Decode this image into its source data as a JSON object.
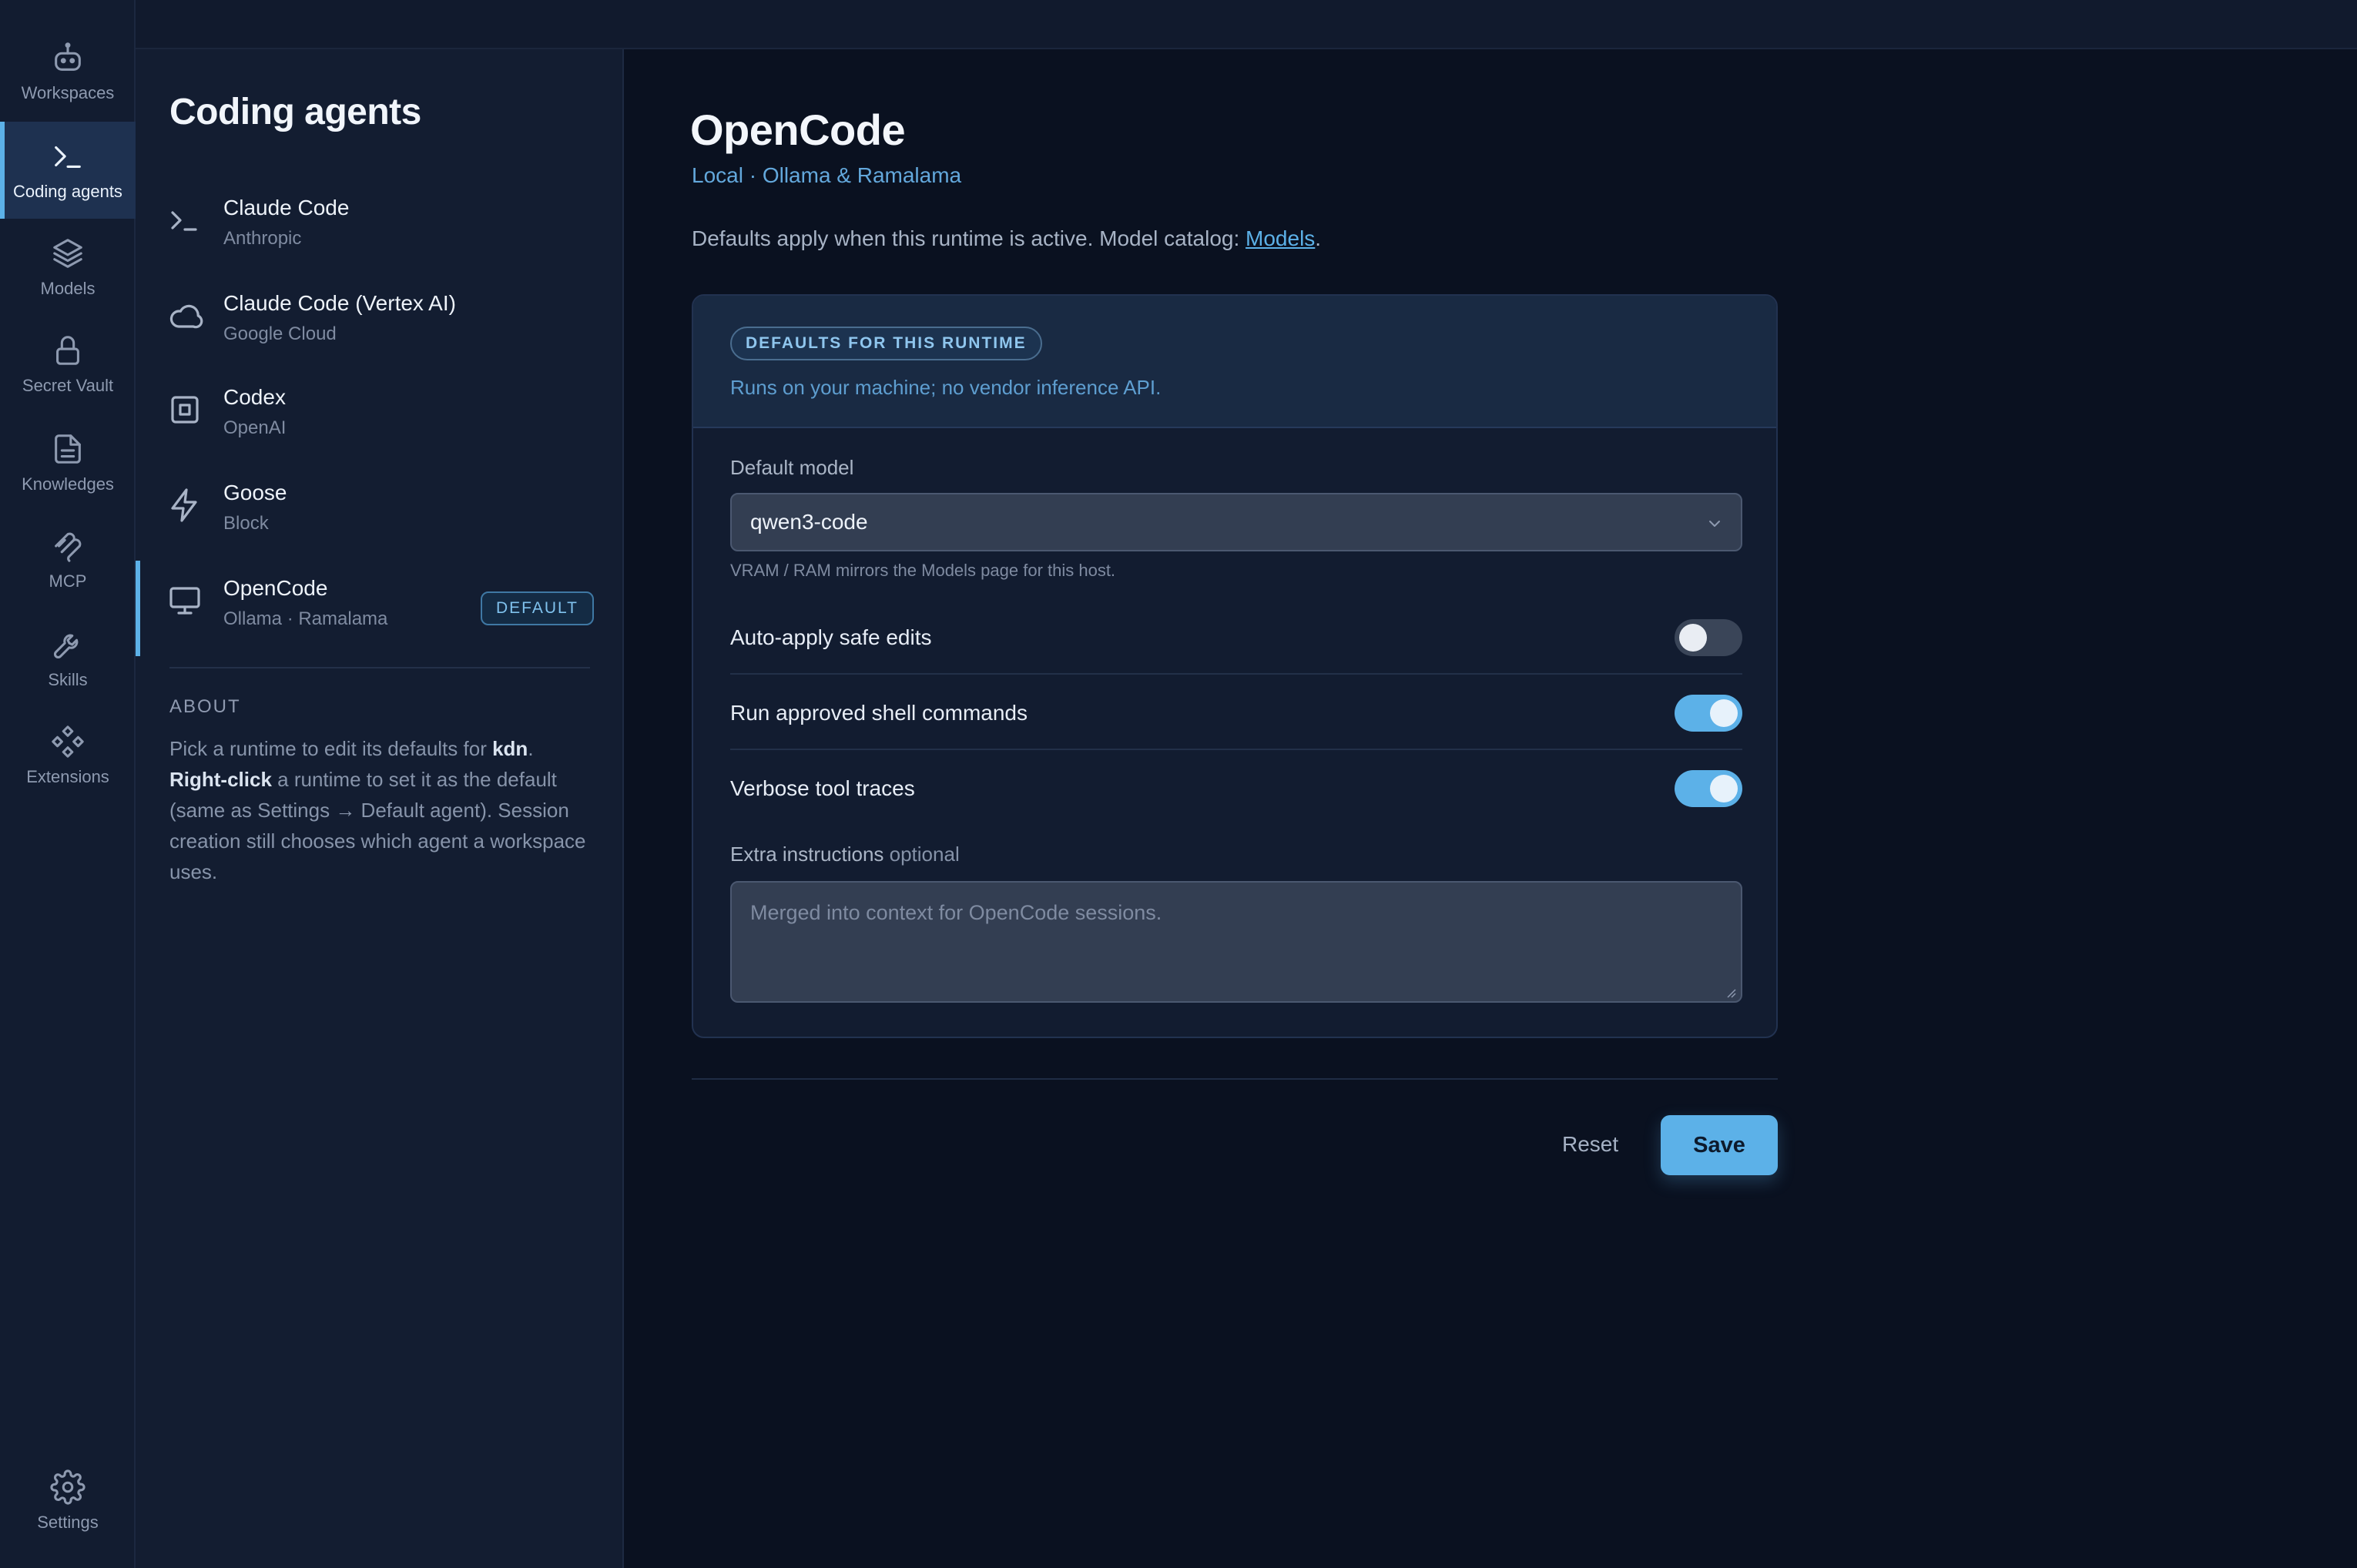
{
  "nav": {
    "items": [
      {
        "label": "Workspaces",
        "icon": "robot-icon",
        "active": false
      },
      {
        "label": "Coding agents",
        "icon": "terminal-icon",
        "active": true
      },
      {
        "label": "Models",
        "icon": "layers-icon",
        "active": false
      },
      {
        "label": "Secret Vault",
        "icon": "lock-icon",
        "active": false
      },
      {
        "label": "Knowledges",
        "icon": "document-icon",
        "active": false
      },
      {
        "label": "MCP",
        "icon": "mcp-icon",
        "active": false
      },
      {
        "label": "Skills",
        "icon": "wrench-icon",
        "active": false
      },
      {
        "label": "Extensions",
        "icon": "extensions-icon",
        "active": false
      }
    ],
    "settings_label": "Settings",
    "accent_color": "#5cb1e8"
  },
  "list": {
    "title": "Coding agents",
    "agents": [
      {
        "name": "Claude Code",
        "subtitle": "Anthropic",
        "icon": "terminal-icon"
      },
      {
        "name": "Claude Code (Vertex AI)",
        "subtitle": "Google Cloud",
        "icon": "cloud-icon"
      },
      {
        "name": "Codex",
        "subtitle": "OpenAI",
        "icon": "chip-icon"
      },
      {
        "name": "Goose",
        "subtitle": "Block",
        "icon": "lightning-icon"
      },
      {
        "name": "OpenCode",
        "subtitle": "Ollama · Ramalama",
        "icon": "monitor-icon",
        "badge": "DEFAULT",
        "selected": true
      }
    ],
    "about": {
      "heading": "ABOUT",
      "p1": "Pick a runtime to edit its defaults for ",
      "user": "kdn",
      "p2": ".",
      "p3_bold": "Right-click",
      "p4": " a runtime to set it as the default (same as Settings → Default agent). Session creation still chooses which agent a workspace uses."
    }
  },
  "detail": {
    "title": "OpenCode",
    "subtitle": "Local · Ollama & Ramalama",
    "description": "Defaults apply when this runtime is active. Model catalog: ",
    "catalog_link": "Models",
    "description_end": ".",
    "card": {
      "pill": "DEFAULTS FOR THIS RUNTIME",
      "note": "Runs on your machine; no vendor inference API.",
      "model_label": "Default model",
      "model_value": "qwen3-code",
      "model_hint": "VRAM / RAM mirrors the Models page for this host.",
      "toggles": [
        {
          "label": "Auto-apply safe edits",
          "on": false
        },
        {
          "label": "Run approved shell commands",
          "on": true
        },
        {
          "label": "Verbose tool traces",
          "on": true
        }
      ],
      "extra_label": "Extra instructions",
      "extra_optional": "optional",
      "extra_placeholder": "Merged into context for OpenCode sessions."
    },
    "reset_label": "Reset",
    "save_label": "Save"
  }
}
